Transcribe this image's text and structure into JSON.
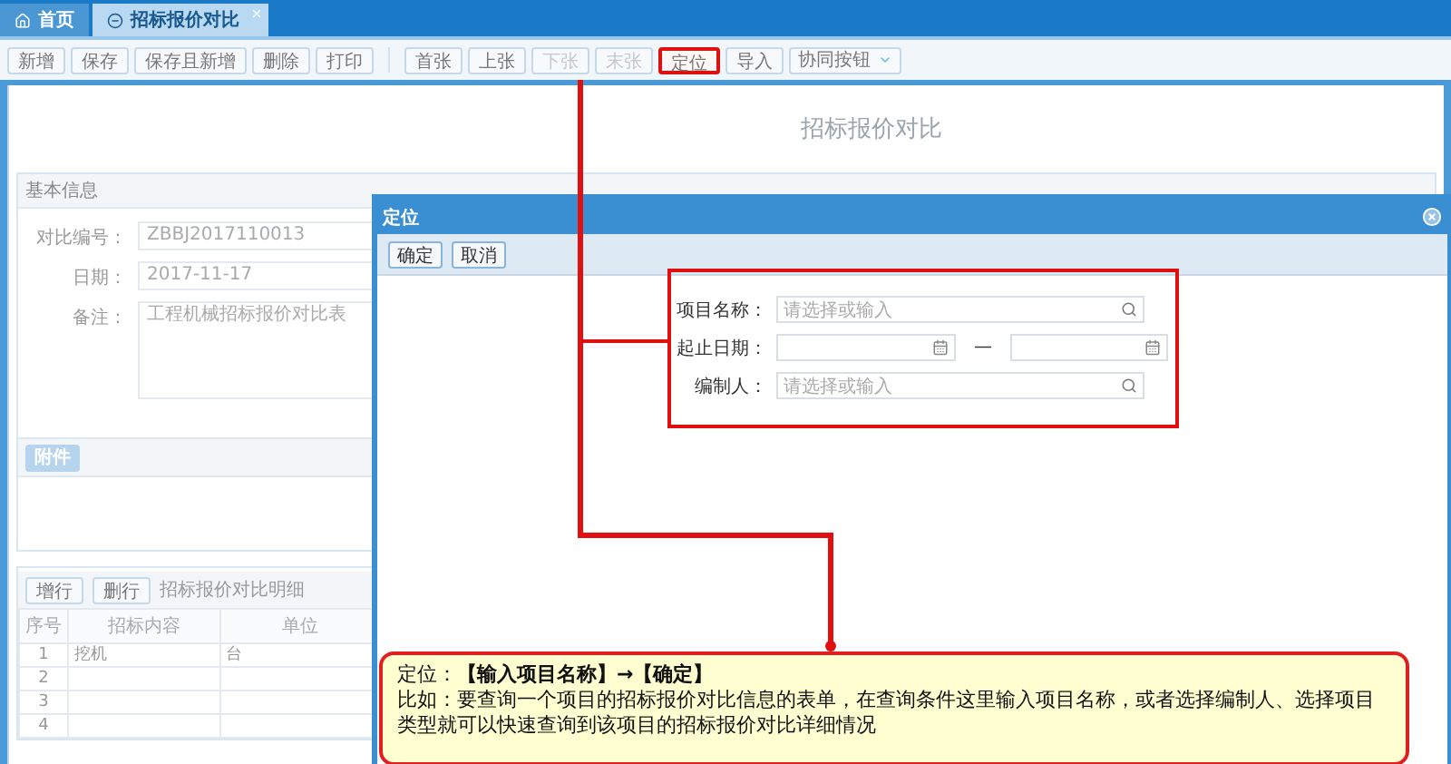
{
  "tabs": [
    {
      "label": "首页",
      "selected": false,
      "kind": "home"
    },
    {
      "label": "招标报价对比",
      "selected": true,
      "kind": "page"
    }
  ],
  "toolbar": {
    "groups": [
      [
        {
          "label": "新增",
          "disabled": false,
          "highlighted": false
        },
        {
          "label": "保存",
          "disabled": false,
          "highlighted": false
        },
        {
          "label": "保存且新增",
          "disabled": false,
          "highlighted": false
        },
        {
          "label": "删除",
          "disabled": false,
          "highlighted": false
        },
        {
          "label": "打印",
          "disabled": false,
          "highlighted": false
        }
      ],
      [
        {
          "label": "首张",
          "disabled": false,
          "highlighted": false
        },
        {
          "label": "上张",
          "disabled": false,
          "highlighted": false
        },
        {
          "label": "下张",
          "disabled": true,
          "highlighted": false
        },
        {
          "label": "末张",
          "disabled": true,
          "highlighted": false
        },
        {
          "label": "定位",
          "disabled": false,
          "highlighted": true
        },
        {
          "label": "导入",
          "disabled": false,
          "highlighted": false
        }
      ]
    ],
    "dropdown": "协同按钮"
  },
  "form": {
    "title": "招标报价对比",
    "section": "基本信息",
    "fields": [
      {
        "label": "对比编号：",
        "value": "ZBBJ2017110013",
        "kind": "text"
      },
      {
        "label": "日期：",
        "value": "2017-11-17",
        "kind": "text"
      },
      {
        "label": "备注：",
        "value": "工程机械招标报价对比表",
        "kind": "textarea"
      }
    ]
  },
  "attachments": {
    "button": "附件"
  },
  "detail": {
    "buttons": [
      "增行",
      "删行"
    ],
    "title": "招标报价对比明细",
    "columns": [
      "序号",
      "招标内容",
      "单位"
    ],
    "rows": [
      {
        "no": "1",
        "content": "挖机",
        "unit": "台"
      },
      {
        "no": "2"
      },
      {
        "no": "3"
      },
      {
        "no": "4"
      }
    ]
  },
  "dialog": {
    "title": "定位",
    "buttons": [
      "确定",
      "取消"
    ],
    "fields": [
      {
        "label": "项目名称：",
        "kind": "search",
        "placeholder": "请选择或输入"
      },
      {
        "label": "起止日期：",
        "kind": "daterange",
        "separator": "—"
      },
      {
        "label": "编制人：",
        "kind": "search",
        "placeholder": "请选择或输入"
      }
    ]
  },
  "annotation": {
    "heading": "定位：**【输入项目名称】→【确定】**",
    "body": "比如：要查询一个项目的招标报价对比信息的表单，在查询条件这里输入项目名称，或者选择编制人、选择项目类型就可以快速查询到该项目的招标报价对比详细情况"
  }
}
